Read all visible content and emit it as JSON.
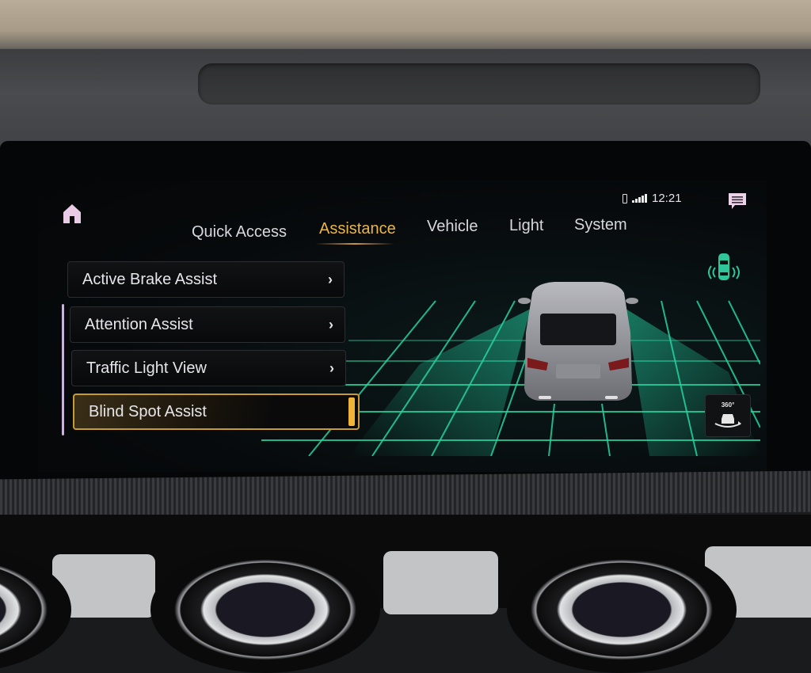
{
  "status_bar": {
    "time": "12:21",
    "battery_icon": "battery-icon",
    "signal_icon": "signal-bars-icon",
    "messages_icon": "message-icon"
  },
  "home_icon": "home-icon",
  "tabs": [
    {
      "label": "Quick Access",
      "active": false
    },
    {
      "label": "Assistance",
      "active": true
    },
    {
      "label": "Vehicle",
      "active": false
    },
    {
      "label": "Light",
      "active": false
    },
    {
      "label": "System",
      "active": false
    }
  ],
  "menu": {
    "items": [
      {
        "label": "Active Brake Assist",
        "type": "submenu"
      },
      {
        "label": "Attention Assist",
        "type": "submenu"
      },
      {
        "label": "Traffic Light View",
        "type": "submenu"
      },
      {
        "label": "Blind Spot Assist",
        "type": "toggle",
        "selected": true,
        "enabled": true
      }
    ]
  },
  "visualization": {
    "blind_spot_status_icon": "car-sensor-icon",
    "camera_button_label": "360°"
  },
  "colors": {
    "accent": "#e9b54c",
    "toggle_on": "#f0b437",
    "sensor_green": "#2fc49a",
    "grid_green": "#27d3a0"
  }
}
